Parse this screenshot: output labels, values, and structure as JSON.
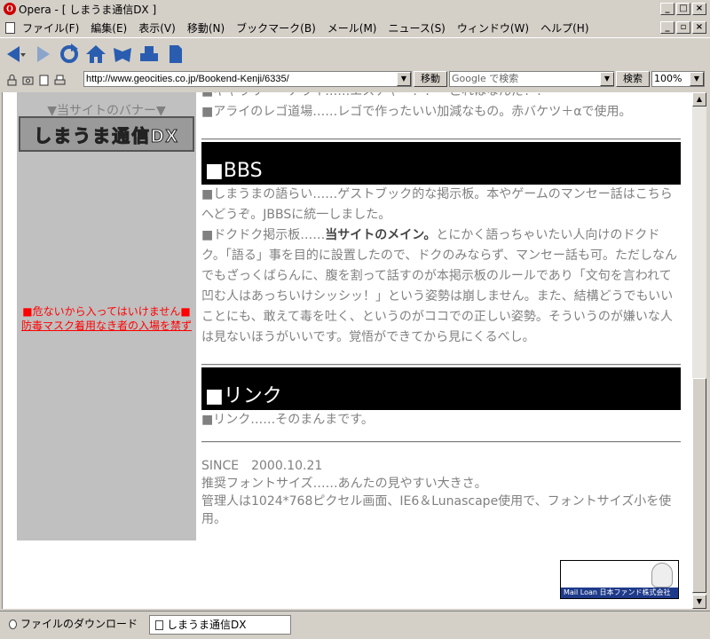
{
  "window": {
    "title": "Opera - [ しまうま通信DX ]"
  },
  "menu": [
    "ファイル(F)",
    "編集(E)",
    "表示(V)",
    "移動(N)",
    "ブックマーク(B)",
    "メール(M)",
    "ニュース(S)",
    "ウィンドウ(W)",
    "ヘルプ(H)"
  ],
  "address": {
    "url": "http://www.geocities.co.jp/Bookend-Kenji/6335/",
    "go_label": "移動",
    "search_placeholder": "Google で検索",
    "search_label": "検索",
    "zoom": "100%"
  },
  "sidebar": {
    "banner_label": "▼当サイトのバナー▼",
    "banner_text": "しまうま通信DX",
    "warning_line1": "■危ないから入ってはいけません■",
    "warning_line2": "防毒マスク着用なき者の入場を禁ず"
  },
  "main": {
    "top_lines": [
      "■ギャラリー・アライ……エスチャー！！　これはなんだ！？",
      "■アライのレゴ道場……レゴで作ったいい加減なもの。赤バケツ＋αで使用。"
    ],
    "bbs_heading": "■BBS",
    "bbs_p1": "■しまうまの語らい……ゲストブック的な掲示板。本やゲームのマンセー話はこちらへどうぞ。JBBSに統一しました。",
    "bbs_p2_prefix": "■ドクドク掲示板……",
    "bbs_p2_strong": "当サイトのメイン。",
    "bbs_p2_rest": "とにかく語っちゃいたい人向けのドクドク。「語る」事を目的に設置したので、ドクのみならず、マンセー話も可。ただしなんでもざっくばらんに、腹を割って話すのが本掲示板のルールであり「文句を言われて凹む人はあっちいけシッシッ！」という姿勢は崩しません。また、結構どうでもいいことにも、敢えて毒を吐く、というのがココでの正しい姿勢。そういうのが嫌いな人は見ないほうがいいです。覚悟ができてから見にくるべし。",
    "link_heading": "■リンク",
    "link_text": "■リンク……そのまんまです。",
    "since": "SINCE　2000.10.21",
    "font_rec": "推奨フォントサイズ……あんたの見やすい大きさ。",
    "admin": "管理人は1024*768ピクセル画面、IE6＆Lunascape使用で、フォントサイズ小を使用。"
  },
  "ad": {
    "text": "Mail Loan  日本ファンド株式会社"
  },
  "statusbar": {
    "download_tab": "ファイルのダウンロード",
    "page_tab": "しまうま通信DX"
  }
}
